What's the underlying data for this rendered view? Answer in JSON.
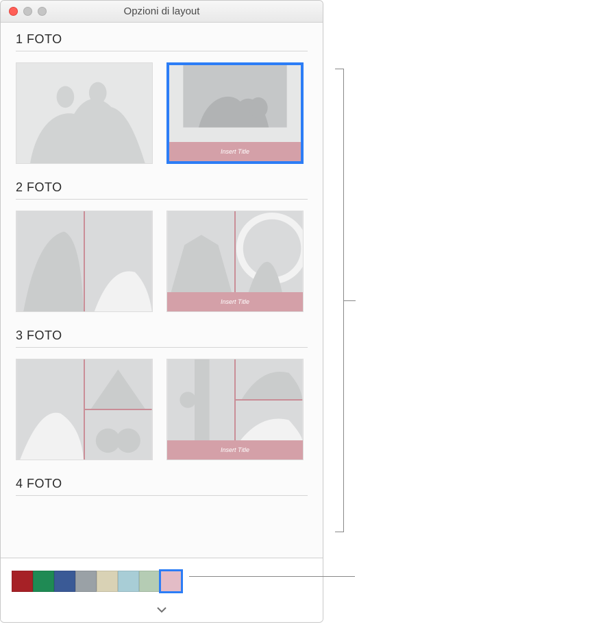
{
  "window": {
    "title": "Opzioni di layout"
  },
  "sections": {
    "s1": {
      "header": "1 FOTO"
    },
    "s2": {
      "header": "2 FOTO"
    },
    "s3": {
      "header": "3 FOTO"
    },
    "s4": {
      "header": "4 FOTO"
    }
  },
  "layouts": {
    "placeholder_title": "Insert Title",
    "selected_index": 1
  },
  "swatches": {
    "colors": [
      "#a62126",
      "#1f8a54",
      "#3a5a96",
      "#9aa1a6",
      "#d9d2b5",
      "#a8cdd6",
      "#b5ccb4",
      "#e3bcc6"
    ],
    "selected_index": 7
  }
}
